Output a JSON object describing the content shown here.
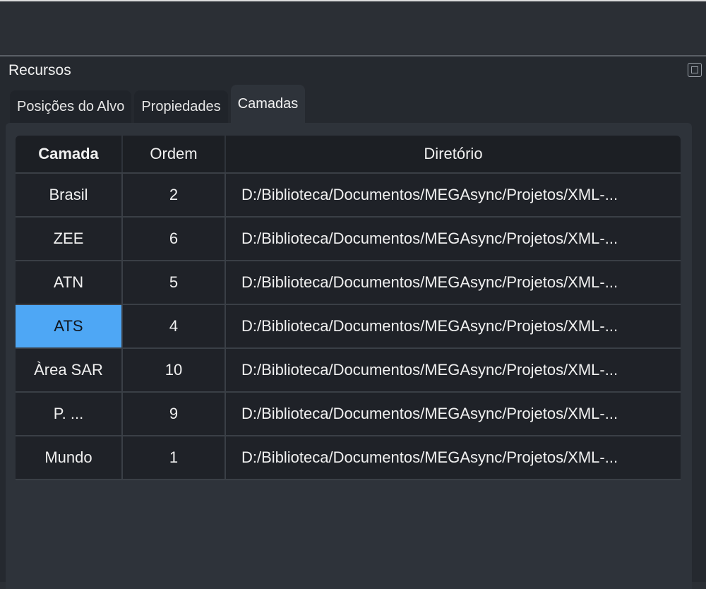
{
  "dock": {
    "title": "Recursos"
  },
  "tabs": [
    {
      "label": "Posições do Alvo",
      "active": false
    },
    {
      "label": "Propiedades",
      "active": false
    },
    {
      "label": "Camadas",
      "active": true
    }
  ],
  "table": {
    "columns": [
      "Camada",
      "Ordem",
      "Diretório"
    ],
    "rows": [
      {
        "camada": "Brasil",
        "ordem": "2",
        "diretorio": "D:/Biblioteca/Documentos/MEGAsync/Projetos/XML-..."
      },
      {
        "camada": "ZEE",
        "ordem": "6",
        "diretorio": "D:/Biblioteca/Documentos/MEGAsync/Projetos/XML-..."
      },
      {
        "camada": "ATN",
        "ordem": "5",
        "diretorio": "D:/Biblioteca/Documentos/MEGAsync/Projetos/XML-..."
      },
      {
        "camada": "ATS",
        "ordem": "4",
        "diretorio": "D:/Biblioteca/Documentos/MEGAsync/Projetos/XML-...",
        "selected": true
      },
      {
        "camada": "Àrea SAR",
        "ordem": "10",
        "diretorio": "D:/Biblioteca/Documentos/MEGAsync/Projetos/XML-..."
      },
      {
        "camada": "P. ...",
        "ordem": "9",
        "diretorio": "D:/Biblioteca/Documentos/MEGAsync/Projetos/XML-..."
      },
      {
        "camada": "Mundo",
        "ordem": "1",
        "diretorio": "D:/Biblioteca/Documentos/MEGAsync/Projetos/XML-..."
      }
    ]
  },
  "colors": {
    "background": "#25292f",
    "selection": "#4ea7f5"
  }
}
